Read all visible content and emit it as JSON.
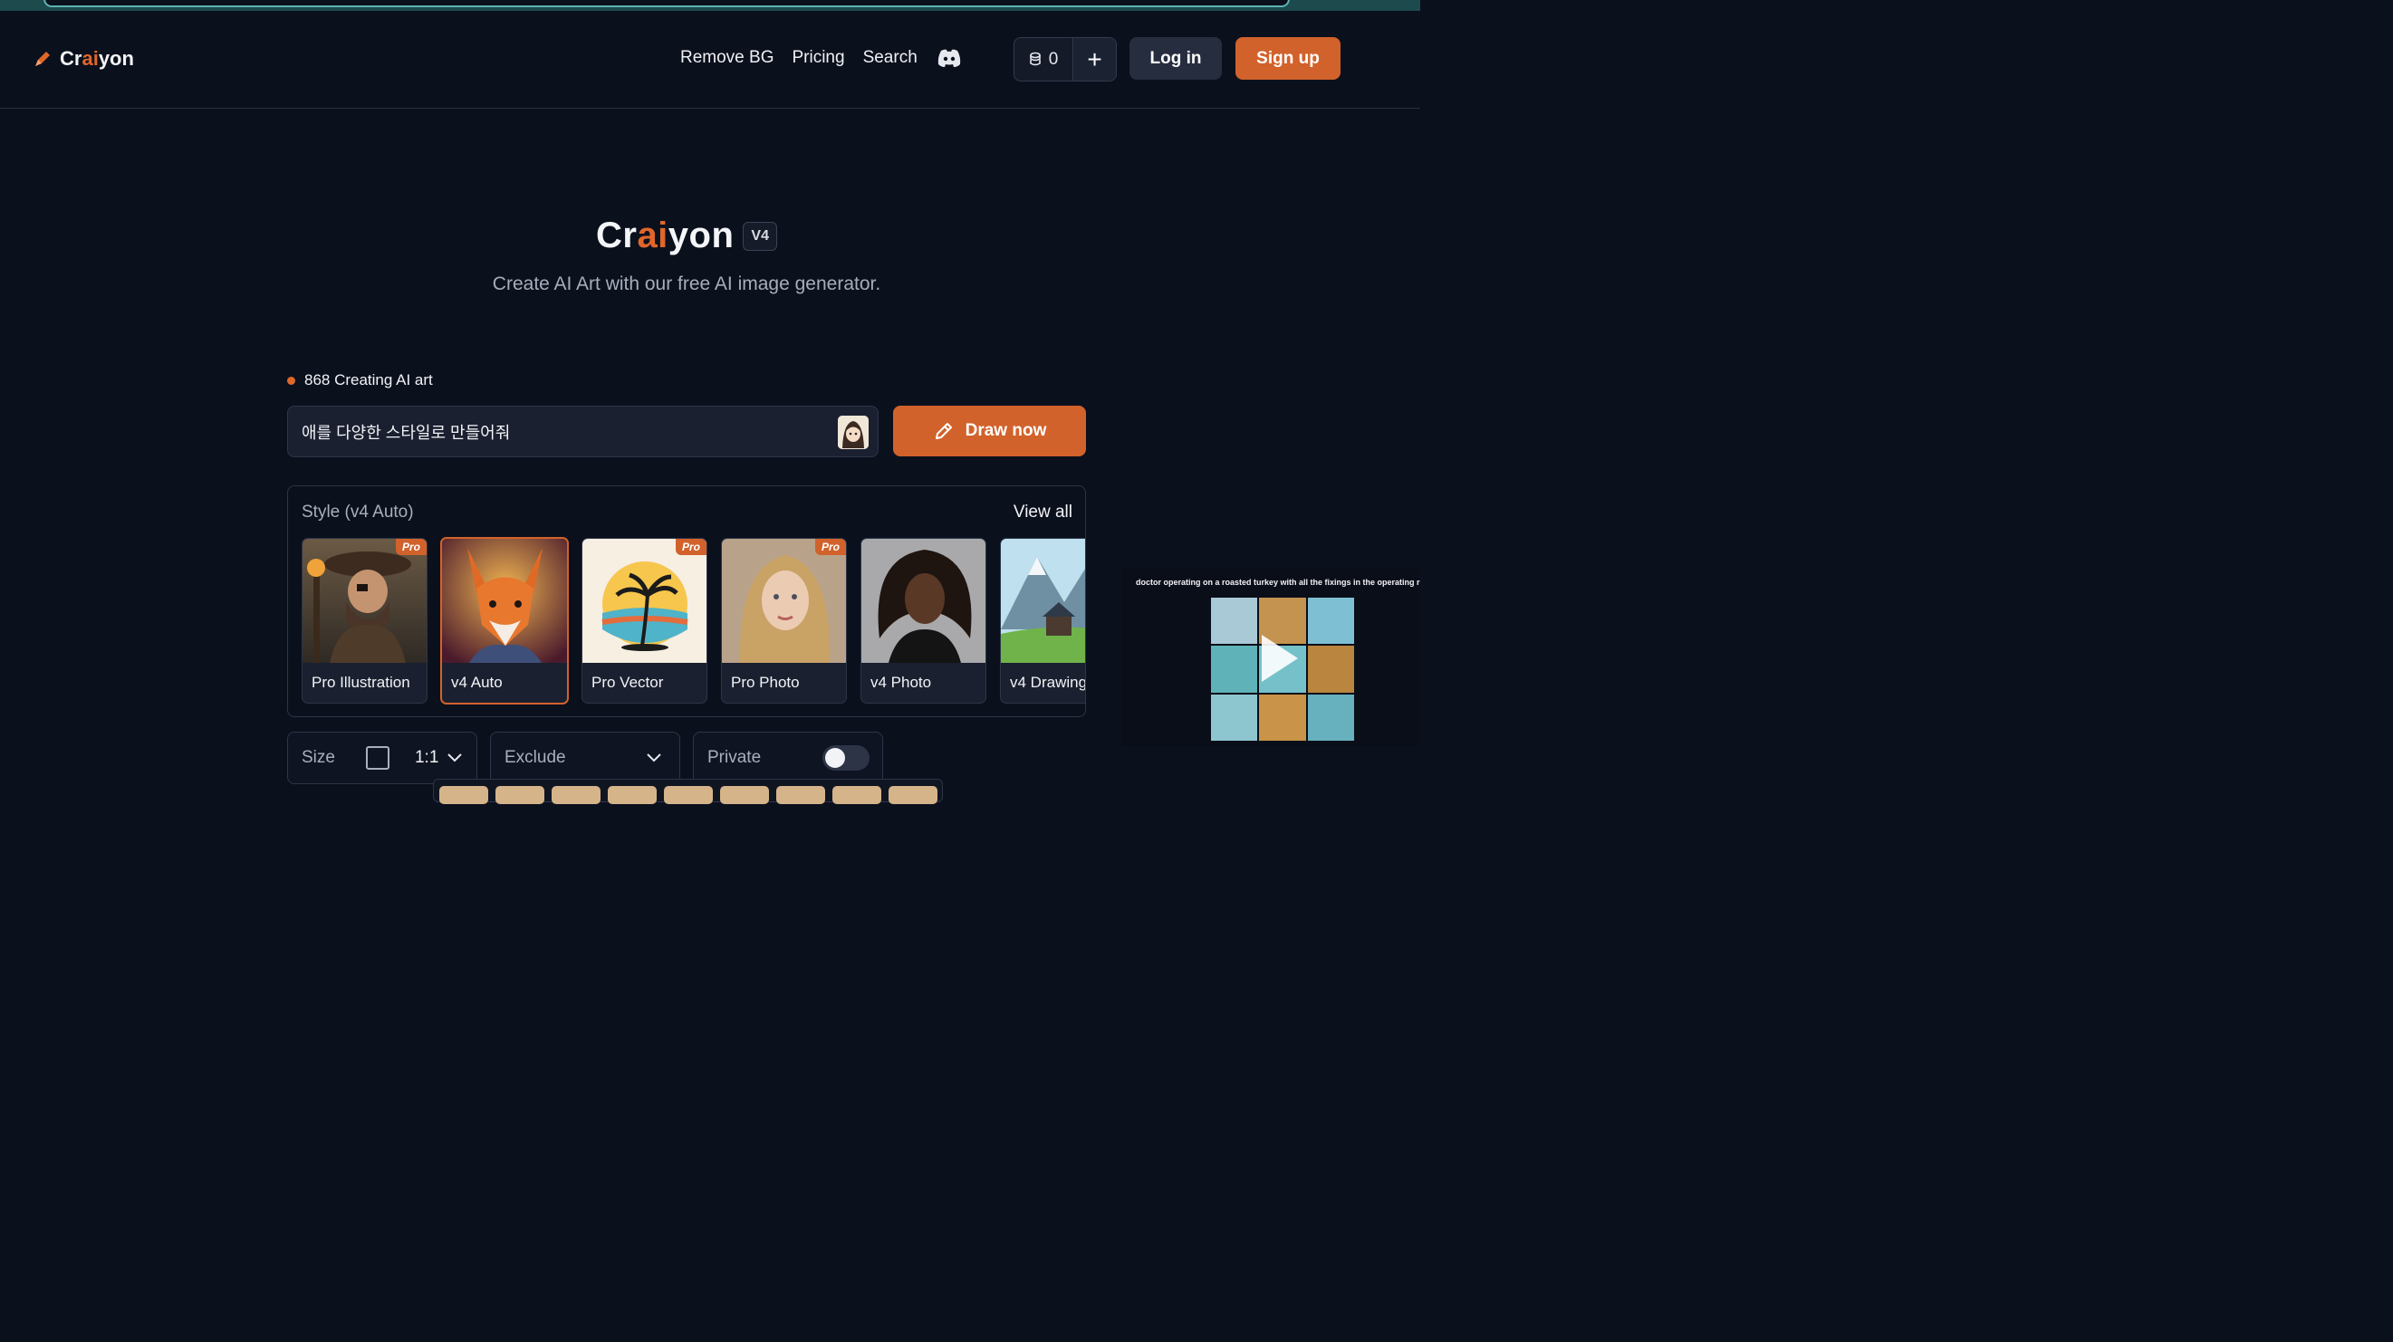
{
  "nav": {
    "logo_prefix": "Cr",
    "logo_ai": "ai",
    "logo_suffix": "yon",
    "links": [
      "Remove BG",
      "Pricing",
      "Search"
    ],
    "credits": "0",
    "login": "Log in",
    "signup": "Sign up"
  },
  "hero": {
    "title_prefix": "Cr",
    "title_ai": "ai",
    "title_suffix": "yon",
    "version": "V4",
    "subtitle": "Create AI Art with our free AI image generator."
  },
  "live": {
    "text": "868 Creating AI art"
  },
  "prompt": {
    "value": "애를 다양한 스타일로 만들어줘"
  },
  "draw_button": "Draw now",
  "style": {
    "heading": "Style (v4 Auto)",
    "view_all": "View all",
    "pro_badge": "Pro",
    "cards": [
      {
        "label": "Pro Illustration",
        "pro": true
      },
      {
        "label": "v4 Auto",
        "pro": false,
        "selected": true
      },
      {
        "label": "Pro Vector",
        "pro": true
      },
      {
        "label": "Pro Photo",
        "pro": true
      },
      {
        "label": "v4 Photo",
        "pro": false
      },
      {
        "label": "v4 Drawing",
        "pro": false
      }
    ]
  },
  "options": {
    "size_label": "Size",
    "size_value": "1:1",
    "exclude_label": "Exclude",
    "private_label": "Private"
  },
  "video": {
    "caption": "doctor operating on a roasted turkey with all the fixings in the operating room"
  },
  "colors": {
    "accent": "#d2622b",
    "background": "#0b101d"
  }
}
